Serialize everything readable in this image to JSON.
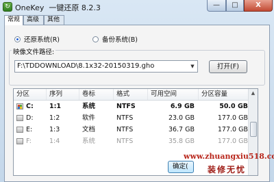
{
  "window": {
    "title": "OneKey  一键还原 8.2.3",
    "app_icon": "onekey-app-icon",
    "minimize": "—",
    "maximize": "□",
    "close": "X"
  },
  "tabs": [
    {
      "label": "常规",
      "active": true
    },
    {
      "label": "高级",
      "active": false
    },
    {
      "label": "其他",
      "active": false
    }
  ],
  "mode": {
    "restore_label": "还原系统(R)",
    "backup_label": "备份系统(B)",
    "selected": "restore"
  },
  "image_path": {
    "group_label": "映像文件路径:",
    "value": "F:\\TDDOWNLOAD\\8.1x32-20150319.gho",
    "open_label": "打开(F)"
  },
  "partition_table": {
    "columns": [
      "分区",
      "序列",
      "卷标",
      "格式",
      "可用空间",
      "分区容量"
    ],
    "rows": [
      {
        "part": "C:",
        "seq": "1:1",
        "vol": "系统",
        "fmt": "NTFS",
        "free": "6.9 GB",
        "size": "50.0 GB",
        "selected": true
      },
      {
        "part": "D:",
        "seq": "1:2",
        "vol": "软件",
        "fmt": "NTFS",
        "free": "23.0 GB",
        "size": "177.0 GB"
      },
      {
        "part": "E:",
        "seq": "1:3",
        "vol": "文档",
        "fmt": "NTFS",
        "free": "36.7 GB",
        "size": "177.0 GB"
      },
      {
        "part": "F:",
        "seq": "1:4",
        "vol": "系统",
        "fmt": "NTFS",
        "free": "35.8 GB",
        "size": "177.0 GB",
        "dim": true
      }
    ]
  },
  "ok_label": "确定(",
  "watermark": {
    "url": "www.zhuangxiu518.com",
    "name": "装修无忧"
  },
  "colors": {
    "accent": "#1f5fd6",
    "close": "#c24a33",
    "watermark": "#b8261b"
  }
}
